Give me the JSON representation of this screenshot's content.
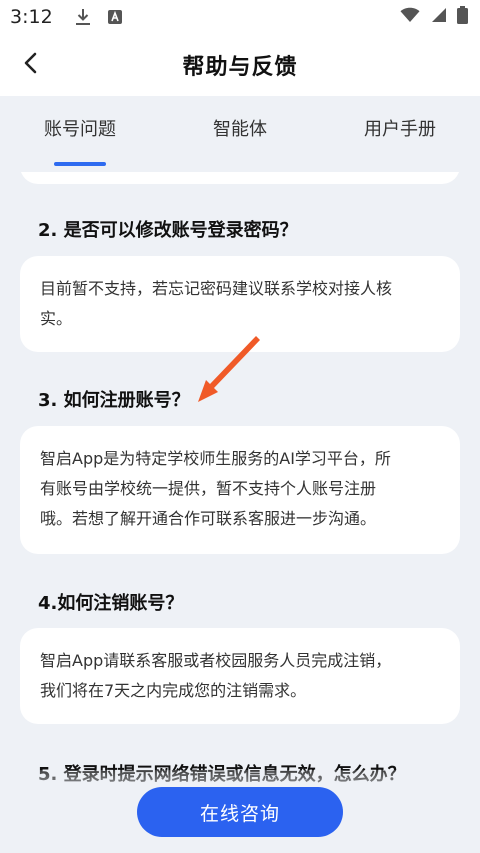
{
  "status_bar": {
    "time": "3:12",
    "icons": [
      "download-icon",
      "app-notification-icon",
      "wifi-icon",
      "signal-icon",
      "battery-icon"
    ]
  },
  "header": {
    "title": "帮助与反馈",
    "back_icon": "chevron-left-icon"
  },
  "tabs": [
    {
      "label": "账号问题",
      "active": true
    },
    {
      "label": "智能体",
      "active": false
    },
    {
      "label": "用户手册",
      "active": false
    }
  ],
  "faq": [
    {
      "question": "2. 是否可以修改账号登录密码？",
      "answer_lines": [
        "目前暂不支持，若忘记密码建议联系学校对接人核",
        "实。"
      ]
    },
    {
      "question": "3. 如何注册账号？",
      "answer_lines": [
        "智启App是为特定学校师生服务的AI学习平台，所",
        "有账号由学校统一提供，暂不支持个人账号注册",
        "哦。若想了解开通合作可联系客服进一步沟通。"
      ]
    },
    {
      "question": "4.如何注销账号？",
      "answer_lines": [
        "智启App请联系客服或者校园服务人员完成注销，",
        "我们将在7天之内完成您的注销需求。"
      ]
    },
    {
      "question": "5. 登录时提示网络错误或信息无效，怎么办？"
    }
  ],
  "consult_button": {
    "label": "在线咨询"
  },
  "colors": {
    "accent": "#2b62f0",
    "background": "#eef1f6",
    "annotation_arrow": "#f05a28"
  }
}
